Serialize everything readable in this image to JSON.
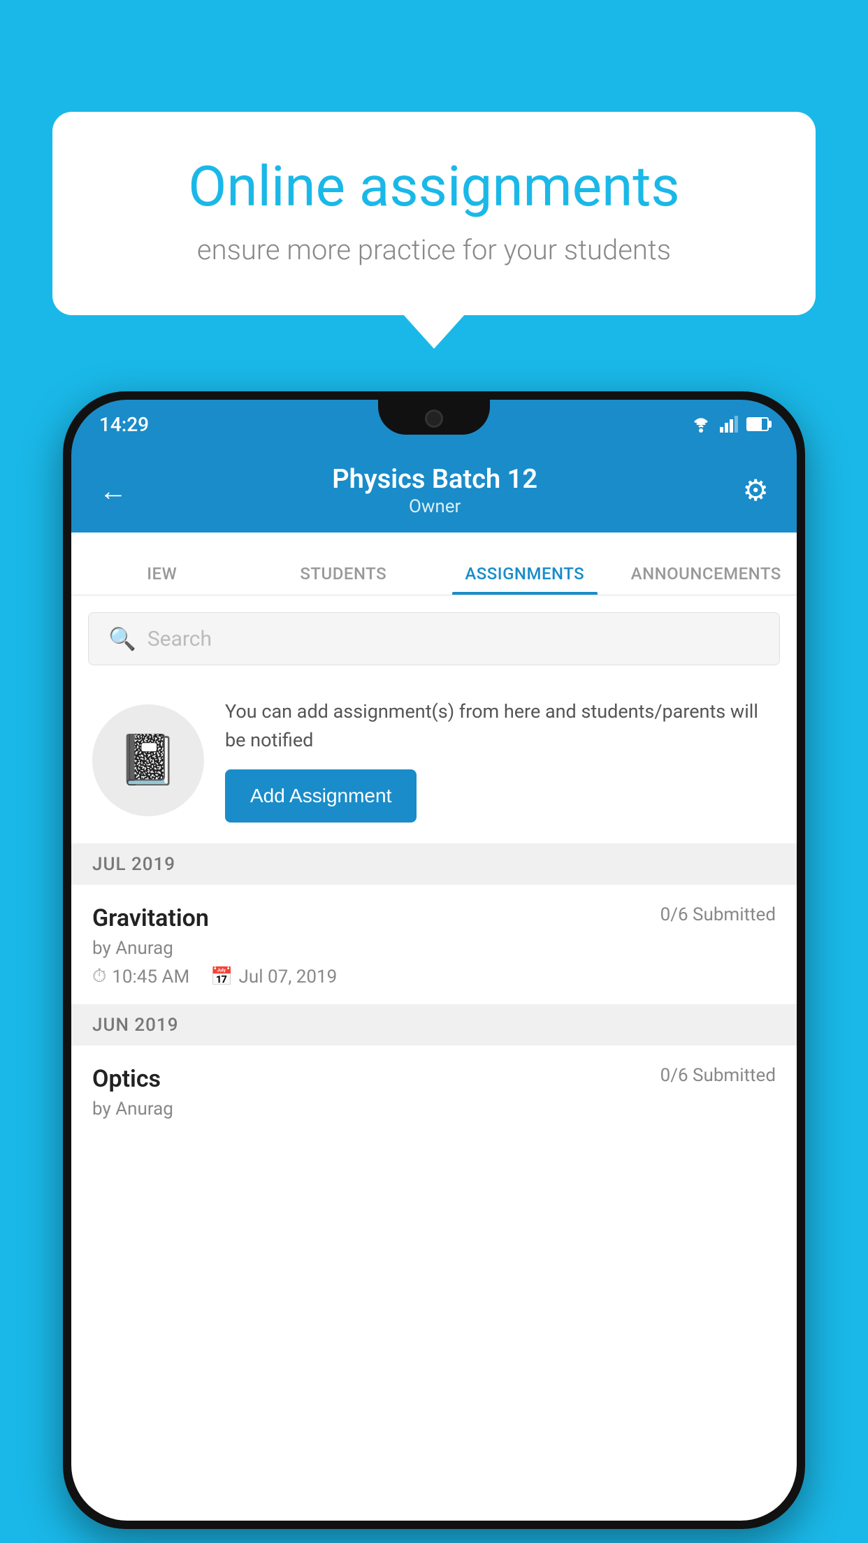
{
  "background_color": "#1ab8e8",
  "speech_bubble": {
    "title": "Online assignments",
    "subtitle": "ensure more practice for your students"
  },
  "phone": {
    "status_bar": {
      "time": "14:29",
      "wifi": true,
      "signal": true,
      "battery": true
    },
    "header": {
      "title": "Physics Batch 12",
      "subtitle": "Owner",
      "back_label": "←",
      "gear_label": "⚙"
    },
    "tabs": [
      {
        "label": "IEW",
        "active": false
      },
      {
        "label": "STUDENTS",
        "active": false
      },
      {
        "label": "ASSIGNMENTS",
        "active": true
      },
      {
        "label": "ANNOUNCEMENTS",
        "active": false
      }
    ],
    "search": {
      "placeholder": "Search"
    },
    "info_card": {
      "description": "You can add assignment(s) from here and students/parents will be notified",
      "add_button_label": "Add Assignment"
    },
    "assignment_groups": [
      {
        "month_label": "JUL 2019",
        "assignments": [
          {
            "name": "Gravitation",
            "submitted": "0/6 Submitted",
            "author": "by Anurag",
            "time": "10:45 AM",
            "date": "Jul 07, 2019"
          }
        ]
      },
      {
        "month_label": "JUN 2019",
        "assignments": [
          {
            "name": "Optics",
            "submitted": "0/6 Submitted",
            "author": "by Anurag",
            "time": "",
            "date": ""
          }
        ]
      }
    ]
  }
}
